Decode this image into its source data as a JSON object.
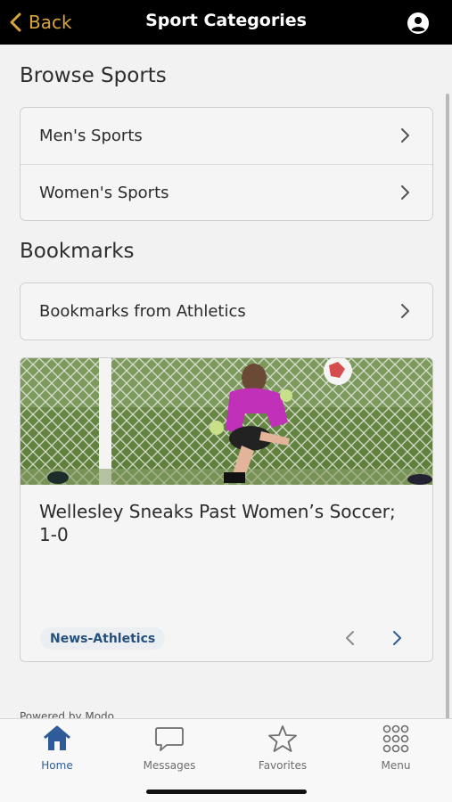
{
  "header": {
    "back_label": "Back",
    "title": "Sport Categories",
    "profile_icon": "user-circle-icon",
    "accent_color": "#d9a53a"
  },
  "browse": {
    "heading": "Browse Sports",
    "items": [
      {
        "label": "Men's Sports"
      },
      {
        "label": "Women's Sports"
      }
    ]
  },
  "bookmarks": {
    "heading": "Bookmarks",
    "items": [
      {
        "label": "Bookmarks from Athletics"
      }
    ]
  },
  "news": {
    "title": "Wellesley Sneaks Past Women’s Soccer; 1-0",
    "tag": "News-Athletics",
    "image_icon": "soccer-goalkeeper-photo"
  },
  "footer": {
    "powered_by": "Powered by Modo"
  },
  "tabbar": {
    "active_color": "#2f5c98",
    "tabs": [
      {
        "label": "Home",
        "icon": "home-icon"
      },
      {
        "label": "Messages",
        "icon": "chat-bubble-icon"
      },
      {
        "label": "Favorites",
        "icon": "star-icon"
      },
      {
        "label": "Menu",
        "icon": "grid-dots-icon"
      }
    ]
  }
}
